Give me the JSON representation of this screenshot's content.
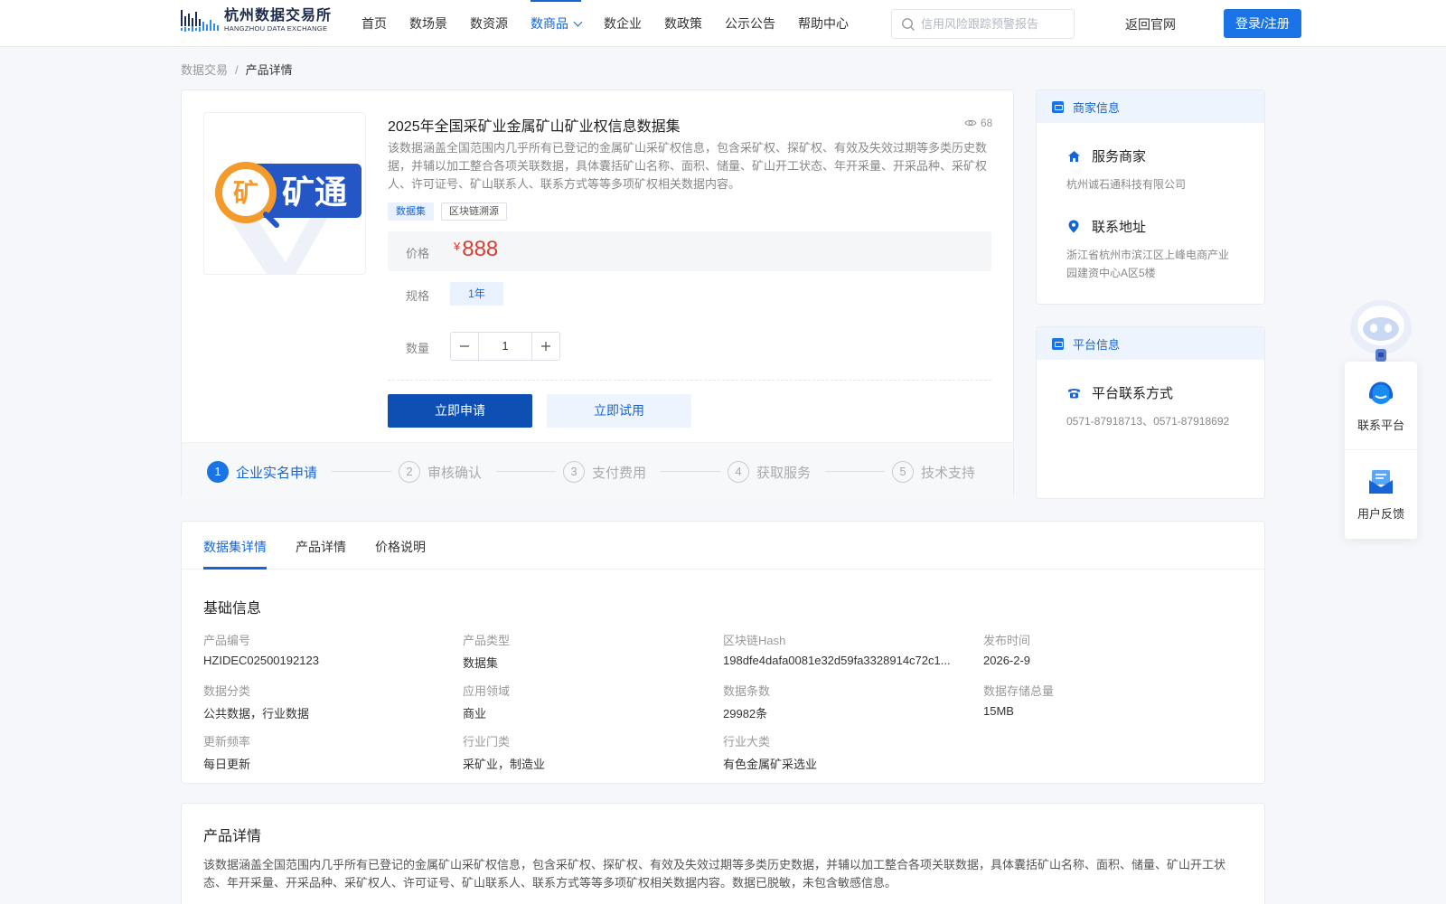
{
  "header": {
    "logo_cn": "杭州数据交易所",
    "logo_en": "HANGZHOU DATA EXCHANGE",
    "nav": [
      {
        "label": "首页"
      },
      {
        "label": "数场景"
      },
      {
        "label": "数资源"
      },
      {
        "label": "数商品",
        "active": true,
        "icon": "chevron-down-icon"
      },
      {
        "label": "数企业"
      },
      {
        "label": "数政策"
      },
      {
        "label": "公示公告"
      },
      {
        "label": "帮助中心"
      }
    ],
    "search_placeholder": "信用风险跟踪预警报告",
    "back_label": "返回官网",
    "login_label": "登录/注册"
  },
  "breadcrumb": {
    "root": "数据交易",
    "separator": "/",
    "current": "产品详情"
  },
  "product": {
    "image_text_left": "矿",
    "image_text_right": "矿通",
    "title": "2025年全国采矿业金属矿山矿业权信息数据集",
    "views": "68",
    "description": "该数据涵盖全国范围内几乎所有已登记的金属矿山采矿权信息，包含采矿权、探矿权、有效及失效过期等多类历史数据，并辅以加工整合各项关联数据，具体囊括矿山名称、面积、储量、矿山开工状态、年开采量、开采品种、采矿权人、许可证号、矿山联系人、联系方式等等多项矿权相关数据内容。",
    "tags": [
      "数据集",
      "区块链溯源"
    ],
    "price_label": "价格",
    "currency": "¥",
    "price": "888",
    "spec_label": "规格",
    "spec_value": "1年",
    "qty_label": "数量",
    "qty_value": "1",
    "apply_label": "立即申请",
    "trial_label": "立即试用"
  },
  "steps": [
    {
      "num": "1",
      "label": "企业实名申请",
      "active": true
    },
    {
      "num": "2",
      "label": "审核确认"
    },
    {
      "num": "3",
      "label": "支付费用"
    },
    {
      "num": "4",
      "label": "获取服务"
    },
    {
      "num": "5",
      "label": "技术支持"
    }
  ],
  "merchant": {
    "head": "商家信息",
    "service_label": "服务商家",
    "service_value": "杭州诚石通科技有限公司",
    "address_label": "联系地址",
    "address_value": "浙江省杭州市滨江区上峰电商产业园建资中心A区5楼"
  },
  "platform": {
    "head": "平台信息",
    "contact_label": "平台联系方式",
    "contact_value": "0571-87918713、0571-87918692"
  },
  "float": {
    "contact_label": "联系平台",
    "feedback_label": "用户反馈"
  },
  "tabs": [
    {
      "label": "数据集详情",
      "active": true
    },
    {
      "label": "产品详情"
    },
    {
      "label": "价格说明"
    }
  ],
  "basic_info": {
    "title": "基础信息",
    "items": [
      {
        "k": "产品编号",
        "v": "HZIDEC02500192123"
      },
      {
        "k": "产品类型",
        "v": "数据集"
      },
      {
        "k": "区块链Hash",
        "v": "198dfe4dafa0081e32d59fa3328914c72c1..."
      },
      {
        "k": "发布时间",
        "v": "2026-2-9"
      },
      {
        "k": "数据分类",
        "v": "公共数据，行业数据"
      },
      {
        "k": "应用领域",
        "v": "商业"
      },
      {
        "k": "数据条数",
        "v": "29982条"
      },
      {
        "k": "数据存储总量",
        "v": "15MB"
      },
      {
        "k": "更新频率",
        "v": "每日更新"
      },
      {
        "k": "行业门类",
        "v": "采矿业，制造业"
      },
      {
        "k": "行业大类",
        "v": "有色金属矿采选业"
      }
    ]
  },
  "detail": {
    "title": "产品详情",
    "text": "该数据涵盖全国范围内几乎所有已登记的金属矿山采矿权信息，包含采矿权、探矿权、有效及失效过期等多类历史数据，并辅以加工整合各项关联数据，具体囊括矿山名称、面积、储量、矿山开工状态、年开采量、开采品种、采矿权人、许可证号、矿山联系人、联系方式等等多项矿权相关数据内容。数据已脱敏，未包含敏感信息。"
  },
  "colors": {
    "accent": "#1565d8",
    "primary_button": "#0e4fb3",
    "price": "#e03b2f"
  }
}
